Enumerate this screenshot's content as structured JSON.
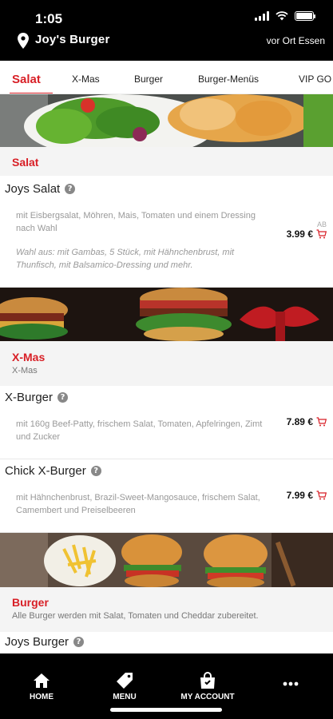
{
  "status_bar": {
    "time": "1:05"
  },
  "header": {
    "store_name": "Joy's Burger",
    "order_mode": "vor Ort Essen"
  },
  "tabs": [
    {
      "label": "Salat",
      "active": true
    },
    {
      "label": "X-Mas",
      "active": false
    },
    {
      "label": "Burger",
      "active": false
    },
    {
      "label": "Burger-Menüs",
      "active": false
    },
    {
      "label": "VIP GO",
      "active": false
    }
  ],
  "sections": {
    "salat": {
      "title": "Salat",
      "items": [
        {
          "name": "Joys Salat",
          "description": "mit Eisbergsalat, Möhren, Mais, Tomaten und einem Dressing nach Wahl",
          "description_extra": "Wahl aus: mit Gambas, 5 Stück, mit Hähnchenbrust, mit Thunfisch, mit Balsamico-Dressing und mehr.",
          "price_prefix": "AB",
          "price": "3.99 €"
        }
      ]
    },
    "xmas": {
      "title": "X-Mas",
      "subtitle": "X-Mas",
      "items": [
        {
          "name": "X-Burger",
          "description": "mit 160g Beef-Patty, frischem Salat, Tomaten, Apfelringen, Zimt und Zucker",
          "price": "7.89 €"
        },
        {
          "name": "Chick X-Burger",
          "description": "mit Hähnchenbrust, Brazil-Sweet-Mangosauce, frischem Salat, Camembert und Preiselbeeren",
          "price": "7.99 €"
        }
      ]
    },
    "burger": {
      "title": "Burger",
      "subtitle": "Alle Burger werden mit Salat, Tomaten und Cheddar zubereitet.",
      "items": [
        {
          "name": "Joys Burger"
        }
      ]
    }
  },
  "bottom_nav": [
    {
      "label": "HOME",
      "icon": "home-icon"
    },
    {
      "label": "MENU",
      "icon": "tag-icon"
    },
    {
      "label": "MY ACCOUNT",
      "icon": "bag-icon"
    },
    {
      "label": "",
      "icon": "more-icon"
    }
  ],
  "colors": {
    "accent": "#d81f26",
    "header_bg": "#000000",
    "section_bg": "#f4f4f4"
  }
}
